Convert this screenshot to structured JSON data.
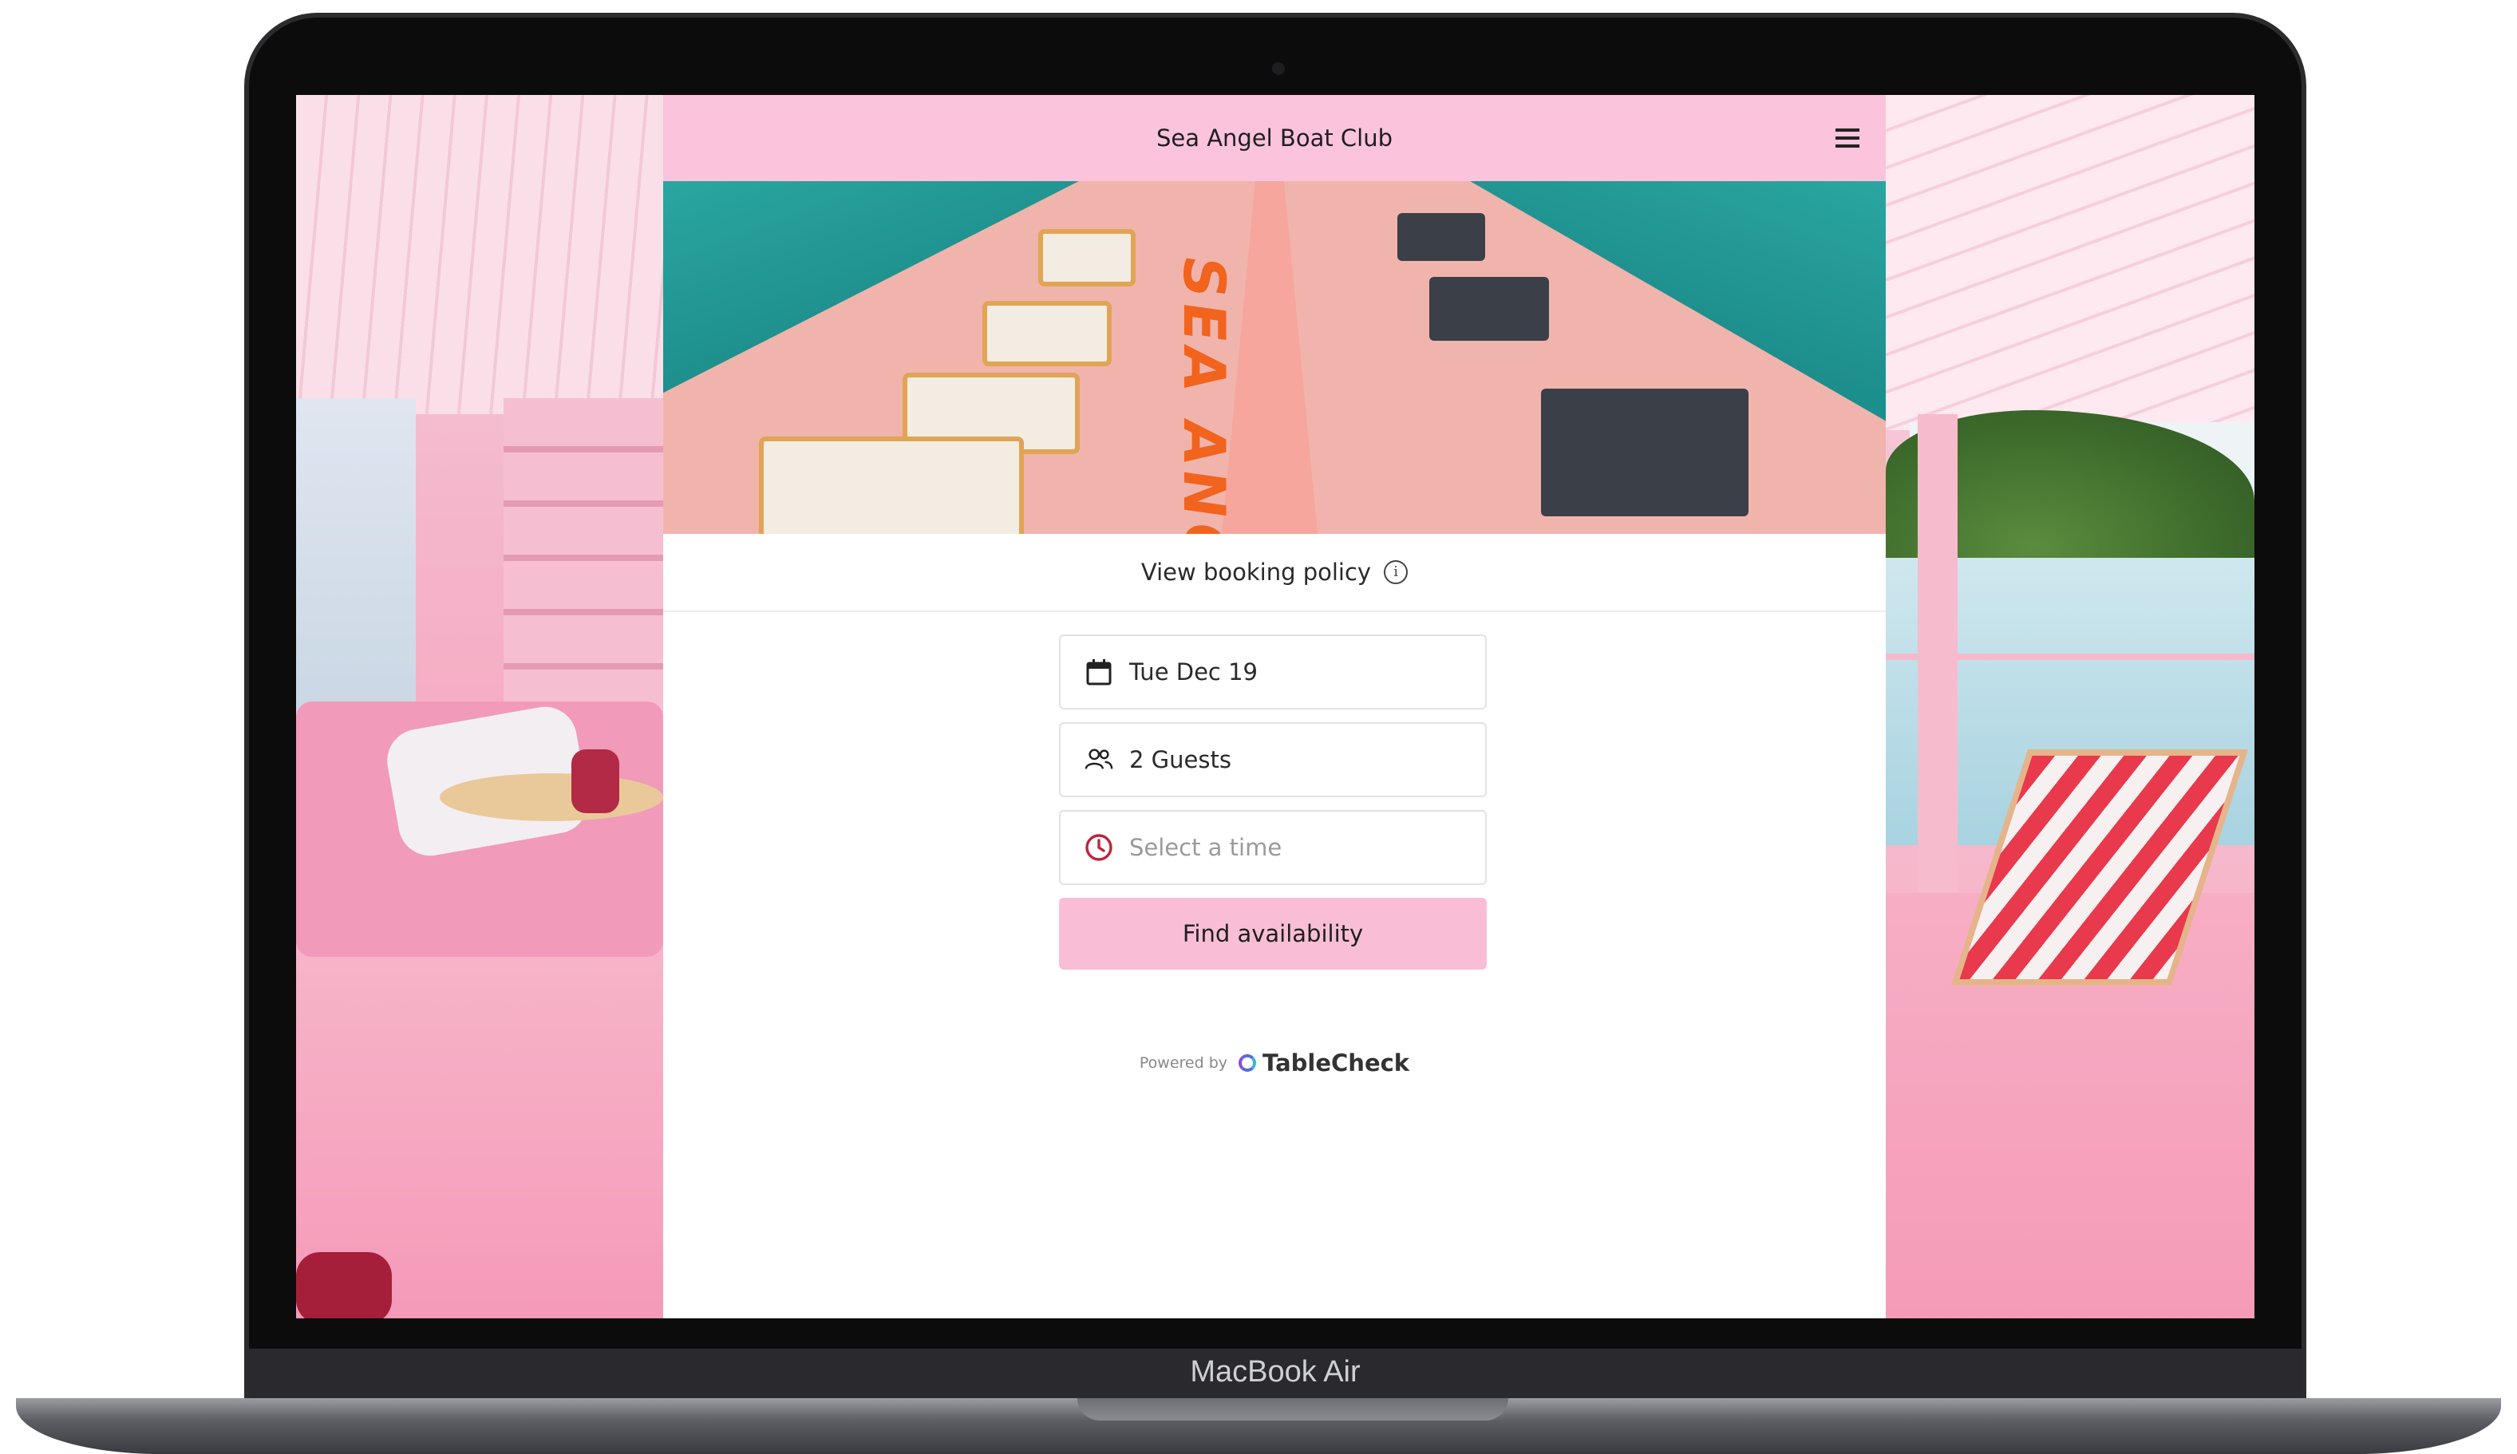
{
  "device": {
    "label": "MacBook Air"
  },
  "header": {
    "title": "Sea Angel Boat Club"
  },
  "hero": {
    "signage": "SEA ANGEL"
  },
  "policy": {
    "link_label": "View booking policy"
  },
  "form": {
    "date_value": "Tue Dec 19",
    "guests_value": "2 Guests",
    "time_placeholder": "Select a time",
    "submit_label": "Find availability"
  },
  "footer": {
    "powered_by": "Powered by",
    "brand": "TableCheck"
  },
  "icons": {
    "menu": "hamburger-icon",
    "info": "info-icon",
    "date": "calendar-icon",
    "guests": "users-icon",
    "time": "clock-icon"
  },
  "colors": {
    "header_bg": "#fbc3dc",
    "button_bg": "#f9bed6",
    "clock_accent": "#c0243b"
  }
}
